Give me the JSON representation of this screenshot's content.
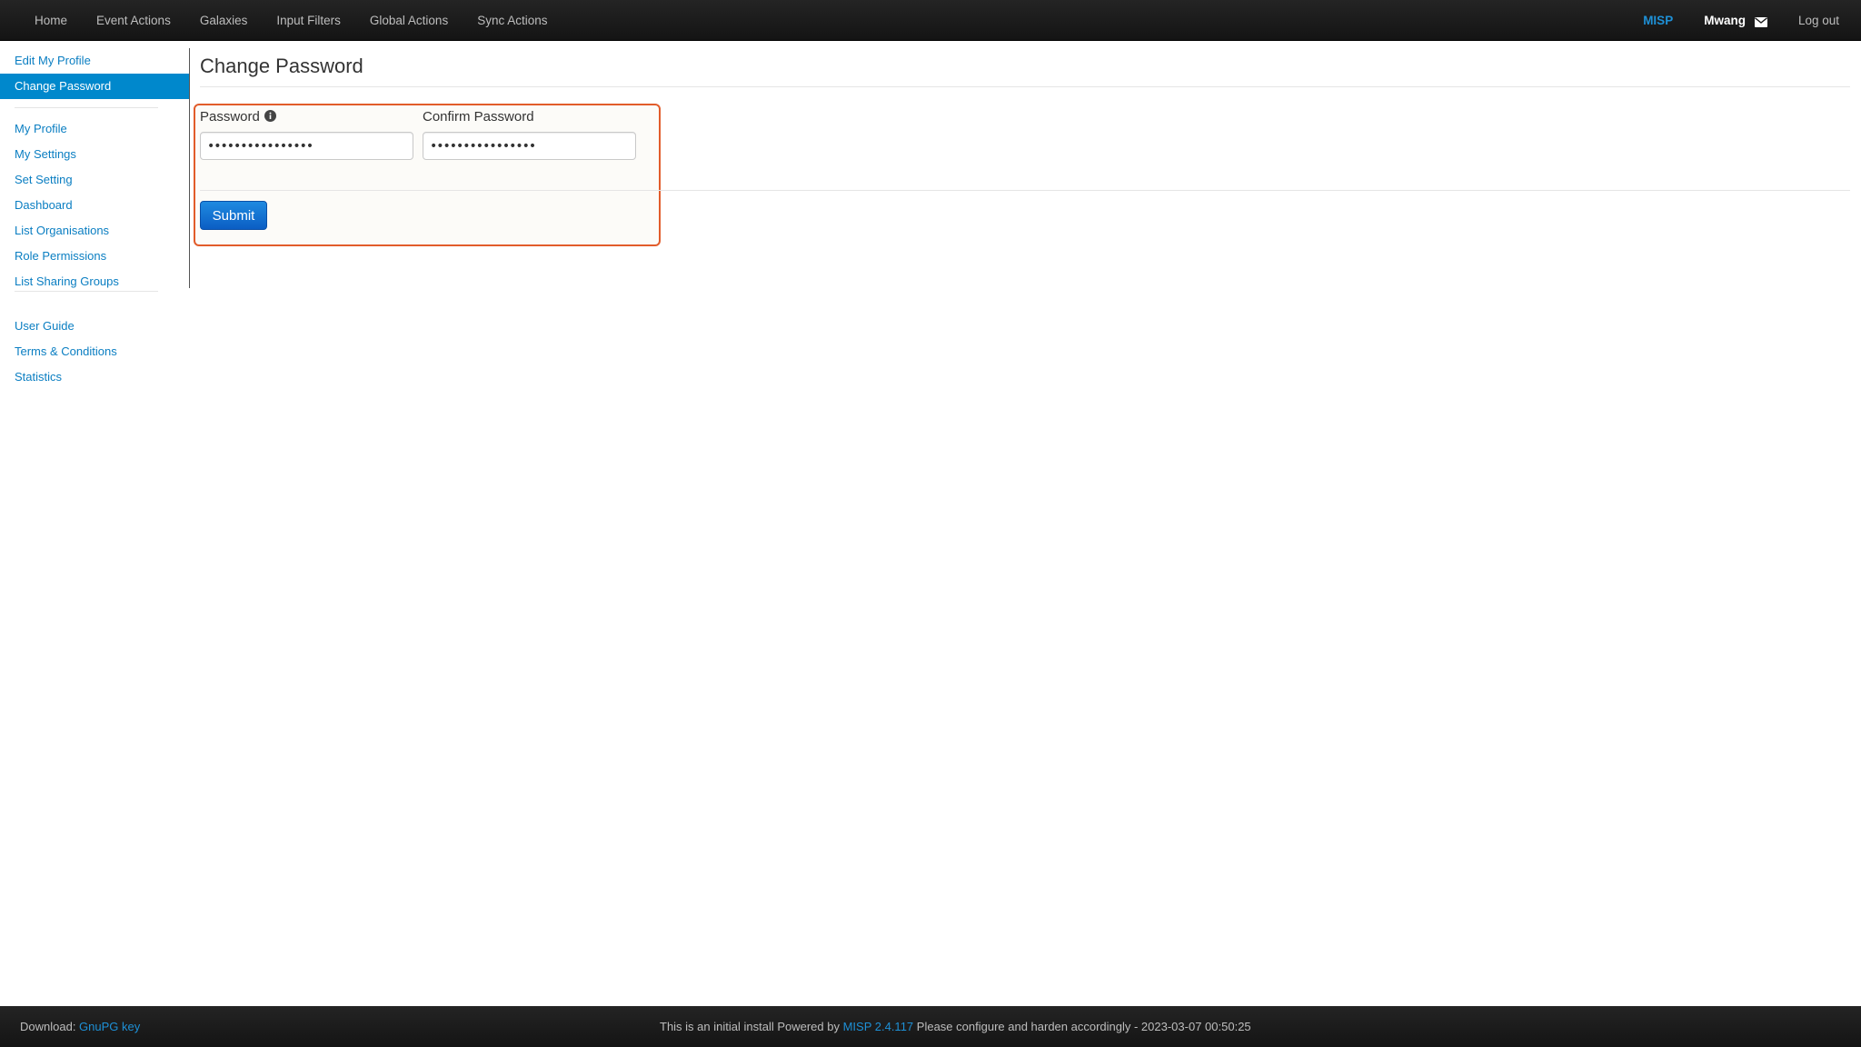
{
  "navbar": {
    "items": [
      "Home",
      "Event Actions",
      "Galaxies",
      "Input Filters",
      "Global Actions",
      "Sync Actions"
    ],
    "brand": "MISP",
    "user": "Mwang",
    "logout": "Log out",
    "envelope_icon": "envelope-icon"
  },
  "sidebar": {
    "items": [
      {
        "label": "Edit My Profile",
        "active": false
      },
      {
        "label": "Change Password",
        "active": true
      }
    ],
    "group2": [
      "My Profile",
      "My Settings",
      "Set Setting",
      "Dashboard",
      "List Organisations",
      "Role Permissions",
      "List Sharing Groups"
    ],
    "group3": [
      "User Guide",
      "Terms & Conditions",
      "Statistics"
    ],
    "active_color": "#0088cc"
  },
  "main": {
    "title": "Change Password",
    "password_label": "Password",
    "password_value": "••••••••••••••••",
    "confirm_label": "Confirm Password",
    "confirm_value": "••••••••••••••••",
    "submit_label": "Submit",
    "info_icon": "info-icon",
    "highlight_color": "#e25c2b"
  },
  "footer": {
    "download_prefix": "Download: ",
    "download_link": "GnuPG key",
    "powered_prefix": "This is an initial install Powered by ",
    "powered_link": "MISP 2.4.117",
    "powered_suffix": " Please configure and harden accordingly - 2023-03-07 00:50:25"
  }
}
